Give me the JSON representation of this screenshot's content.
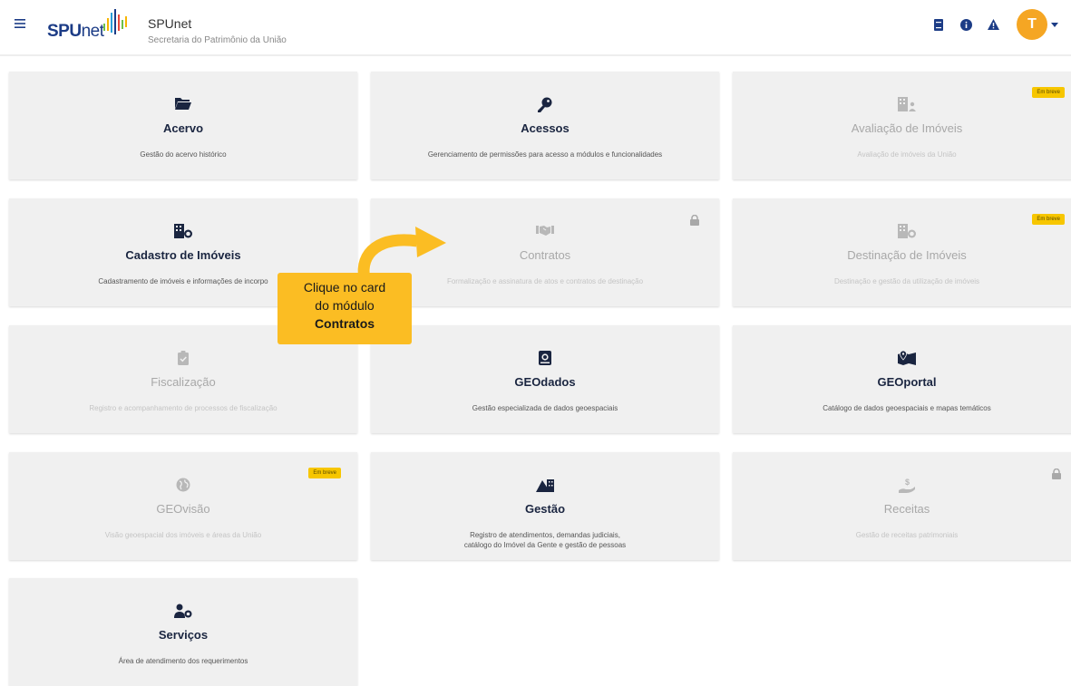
{
  "header": {
    "logo_bold": "SPU",
    "logo_light": "net",
    "title": "SPUnet",
    "subtitle": "Secretaria do Patrimônio da União",
    "avatar_initial": "T",
    "icons": [
      "menu-icon",
      "book-icon",
      "info-icon",
      "warning-icon"
    ]
  },
  "colors": {
    "navy": "#1c3c86",
    "card_bg": "#f0f0f0",
    "badge": "#f7c600",
    "avatar": "#f5a623",
    "callout": "#fbbd23"
  },
  "cards": [
    {
      "title": "Acervo",
      "description": "Gestão do acervo histórico",
      "icon": "folder-icon",
      "state": "active"
    },
    {
      "title": "Acessos",
      "description": "Gerenciamento de permissões para acesso a módulos e funcionalidades",
      "icon": "key-icon",
      "state": "active"
    },
    {
      "title": "Avaliação de Imóveis",
      "description": "Avaliação de imóveis da União",
      "icon": "building-user-icon",
      "state": "disabled",
      "badge": "Em breve"
    },
    {
      "title": "Cadastro de Imóveis",
      "description": "Cadastramento de imóveis e informações de incorpo",
      "icon": "building-check-icon",
      "state": "active"
    },
    {
      "title": "Contratos",
      "description": "Formalização e assinatura de atos e contratos de destinação",
      "icon": "handshake-icon",
      "state": "locked"
    },
    {
      "title": "Destinação de Imóveis",
      "description": "Destinação e gestão da utilização de imóveis",
      "icon": "building-check-icon",
      "state": "disabled",
      "badge": "Em breve"
    },
    {
      "title": "Fiscalização",
      "description": "Registro e acompanhamento de processos de fiscalização",
      "icon": "clipboard-check-icon",
      "state": "disabled"
    },
    {
      "title": "GEOdados",
      "description": "Gestão especializada de dados geoespaciais",
      "icon": "database-icon",
      "state": "active"
    },
    {
      "title": "GEOportal",
      "description": "Catálogo de dados geoespaciais e mapas temáticos",
      "icon": "map-pin-icon",
      "state": "active"
    },
    {
      "title": "GEOvisão",
      "description": "Visão geoespacial dos imóveis e áreas da União",
      "icon": "globe-icon",
      "state": "disabled",
      "badge": "Em breve"
    },
    {
      "title": "Gestão",
      "description_lines": [
        "Registro de atendimentos, demandas judiciais,",
        "catálogo do Imóvel da Gente e gestão de pessoas"
      ],
      "icon": "mountain-building-icon",
      "state": "active"
    },
    {
      "title": "Receitas",
      "description": "Gestão de receitas patrimoniais",
      "icon": "hand-coin-icon",
      "state": "locked"
    },
    {
      "title": "Serviços",
      "description": "Área de atendimento dos requerimentos",
      "icon": "user-gear-icon",
      "state": "active"
    }
  ],
  "callout": {
    "line1": "Clique no card",
    "line2": "do módulo",
    "line3": "Contratos"
  }
}
